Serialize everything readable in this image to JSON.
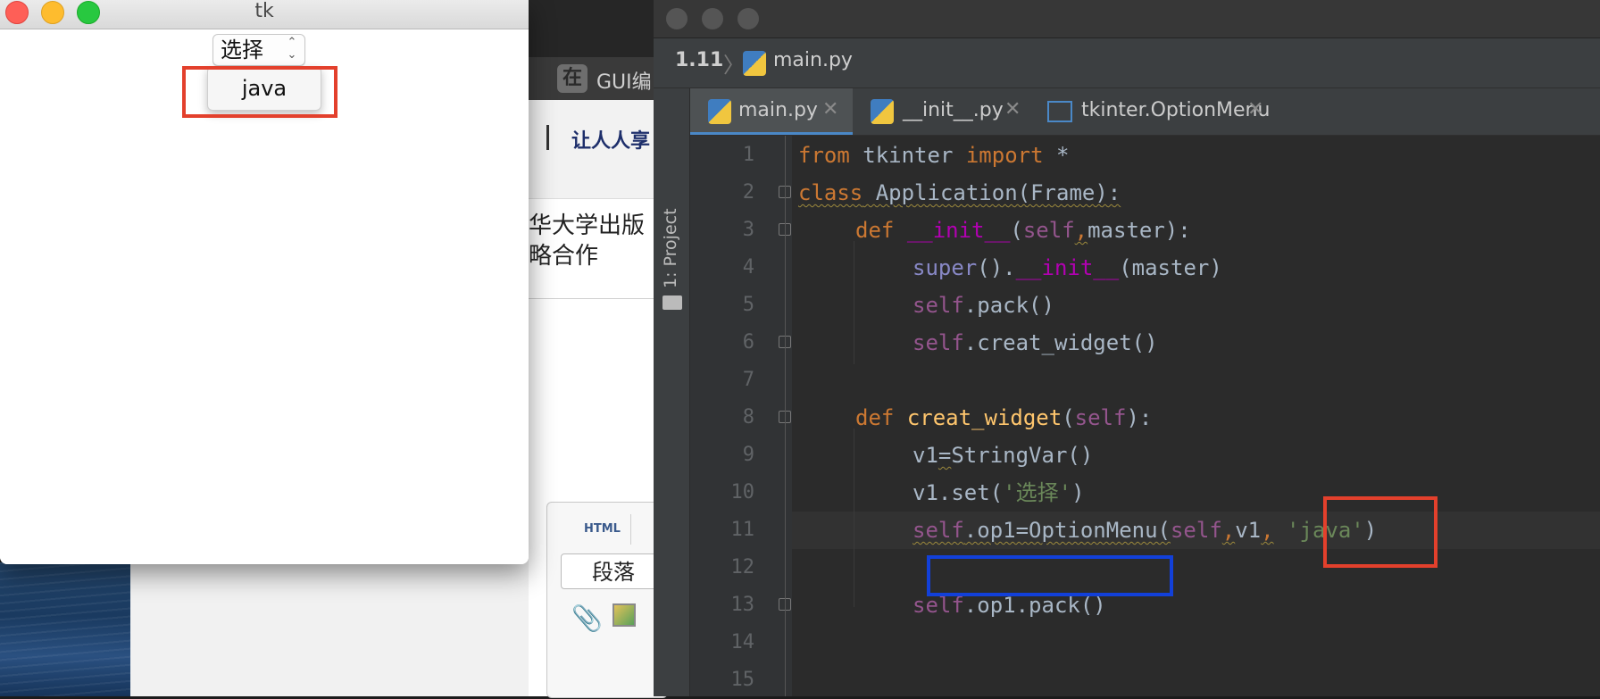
{
  "background_browser": {
    "tab_icon_glyph": "在",
    "tab_label": "GUI编",
    "logo_text": "让人人享",
    "text_line1": "华大学出版",
    "text_line2": "略合作",
    "editor": {
      "html_button": "HTML",
      "paragraph_select": "段落"
    }
  },
  "tk_window": {
    "title": "tk",
    "option_menu_value": "选择",
    "dropdown_items": [
      "java"
    ]
  },
  "ide": {
    "breadcrumb": {
      "project": "1.11",
      "file": "main.py"
    },
    "side_panel_label": "1: Project",
    "tabs": [
      {
        "label": "main.py",
        "active": true
      },
      {
        "label": "__init__.py",
        "active": false
      },
      {
        "label": "tkinter.OptionMenu",
        "active": false
      }
    ],
    "line_numbers": [
      "1",
      "2",
      "3",
      "4",
      "5",
      "6",
      "7",
      "8",
      "9",
      "10",
      "11",
      "12",
      "13",
      "14",
      "15"
    ],
    "code": {
      "l1": {
        "a": "from",
        "b": " tkinter ",
        "c": "import",
        "d": " *"
      },
      "l2": {
        "a": "class",
        "b": " Application(Frame):"
      },
      "l3": {
        "a": "def",
        "b": " ",
        "c": "__init__",
        "d": "(",
        "e": "self",
        "f": ",",
        "g": "master):"
      },
      "l4": {
        "a": "super",
        "b": "().",
        "c": "__init__",
        "d": "(master)"
      },
      "l5": {
        "a": "self",
        "b": ".pack()"
      },
      "l6": {
        "a": "self",
        "b": ".creat_widget()"
      },
      "l8": {
        "a": "def",
        "b": " ",
        "c": "creat_widget",
        "d": "(",
        "e": "self",
        "f": "):"
      },
      "l9": {
        "a": "v1",
        "b": "=",
        "c": "StringVar()"
      },
      "l10": {
        "a": "v1.set(",
        "b": "'选择'",
        "c": ")"
      },
      "l11": {
        "a": "self",
        "b": ".op1=OptionMenu(",
        "c": "self",
        "d": ",",
        "e": "v1",
        "f": ",",
        "g": " ",
        "h": "'java'",
        "i": ")"
      },
      "l13": {
        "a": "self",
        "b": ".op1.pack()"
      }
    }
  }
}
